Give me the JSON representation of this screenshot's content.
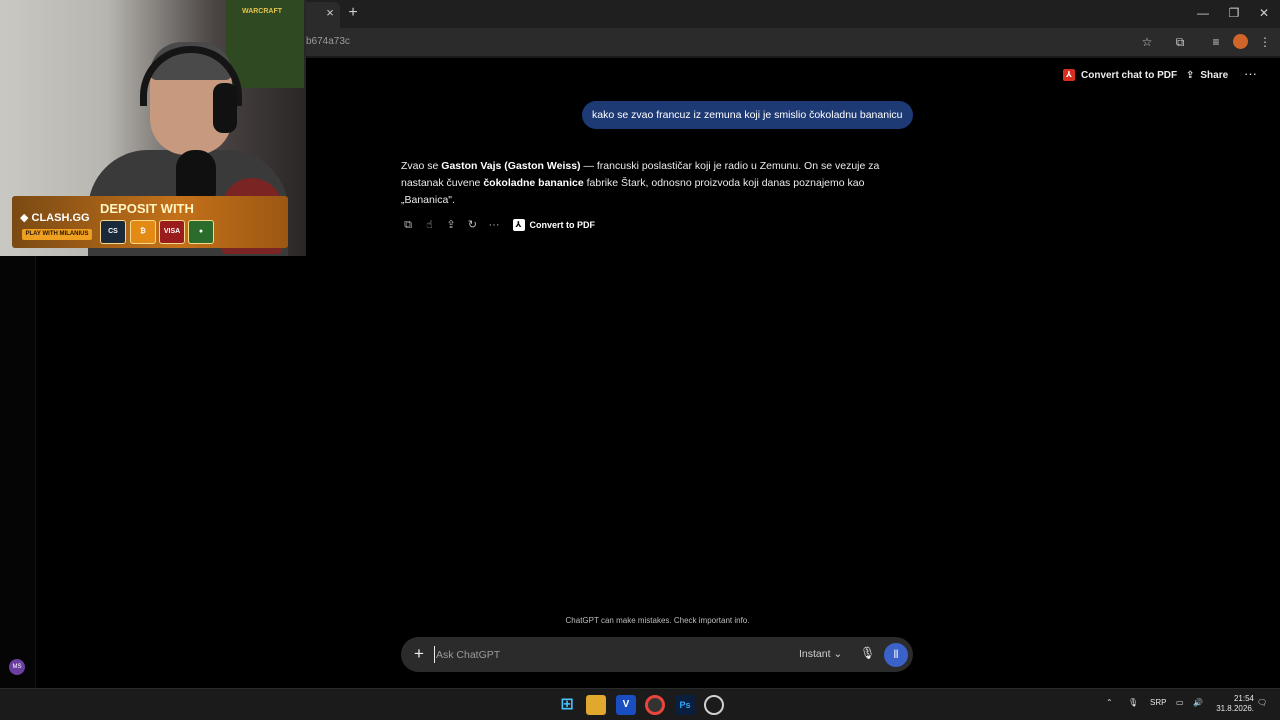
{
  "browser": {
    "url_fragment": "b674a73c",
    "tab_close": "×",
    "new_tab": "+",
    "window_buttons": [
      "—",
      "❐",
      "✕"
    ]
  },
  "header": {
    "convert_chat_pdf": "Convert chat to PDF",
    "share": "Share",
    "more": "···"
  },
  "conversation": {
    "user_message": "kako se zvao francuz iz zemuna koji je smislio čokoladnu bananicu",
    "assistant": {
      "p1_a": "Zvao se ",
      "p1_bold1": "Gaston Vajs (Gaston Weiss)",
      "p1_b": " — francuski poslastičar koji je radio u Zemunu. On se vezuje za nastanak čuvene ",
      "p1_bold2": "čokoladne bananice",
      "p1_c": " fabrike Štark, odnosno proizvoda koji danas poznajemo kao „Bananica\"."
    },
    "actions": {
      "convert_pdf": "Convert to PDF",
      "more": "···"
    }
  },
  "composer": {
    "placeholder": "Ask ChatGPT",
    "model": "Instant ⌄",
    "disclaimer": "ChatGPT can make mistakes. Check important info."
  },
  "sidebar": {
    "avatar_initials": "MS"
  },
  "webcam": {
    "poster_text": "WARCRAFT",
    "banner_logo": "◆ CLASH.GG",
    "banner_sub": "PLAY WITH MILANIUS",
    "banner_title": "DEPOSIT WITH",
    "pay_methods": [
      "CS",
      "₿",
      "VISA",
      "●"
    ]
  },
  "taskbar": {
    "language": "SRP",
    "time": "21:54",
    "date": "31.8.2026."
  },
  "colors": {
    "user_bubble": "#1e3a75",
    "voice_button": "#3a62c9",
    "pdf_red": "#d92d20"
  }
}
